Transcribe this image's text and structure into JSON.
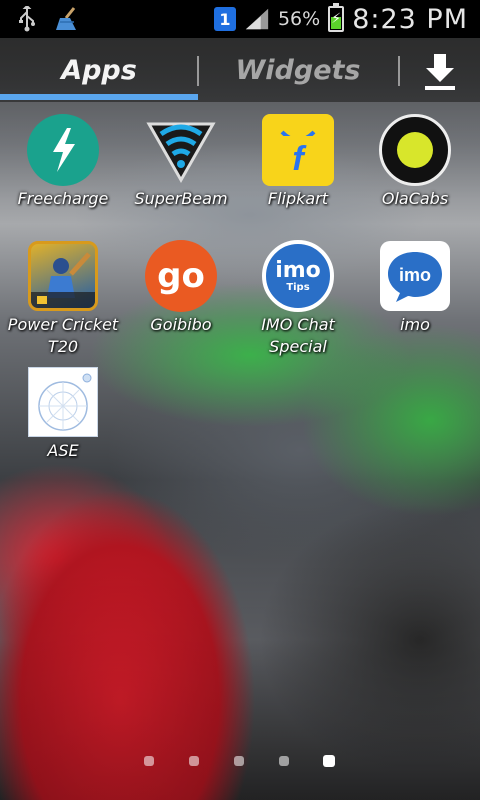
{
  "status_bar": {
    "left_icons": [
      "usb-icon",
      "broom-cleaner-icon"
    ],
    "sim_label": "1",
    "battery_percent": "56%",
    "battery_level": 0.56,
    "time": "8:23 PM"
  },
  "tabs": {
    "apps_label": "Apps",
    "widgets_label": "Widgets",
    "active": "apps"
  },
  "apps": [
    {
      "label": "Freecharge",
      "icon": "freecharge-icon"
    },
    {
      "label": "SuperBeam",
      "icon": "superbeam-icon"
    },
    {
      "label": "Flipkart",
      "icon": "flipkart-icon"
    },
    {
      "label": "OlaCabs",
      "icon": "olacabs-icon"
    },
    {
      "label": "Power Cricket\nT20",
      "icon": "power-cricket-icon"
    },
    {
      "label": "Goibibo",
      "icon": "goibibo-icon"
    },
    {
      "label": "IMO Chat\nSpecial",
      "icon": "imo-tips-icon",
      "badge_text": "imo",
      "badge_subtext": "Tips"
    },
    {
      "label": "imo",
      "icon": "imo-icon",
      "badge_text": "imo"
    },
    {
      "label": "ASE",
      "icon": "ase-icon"
    }
  ],
  "goibibo_text": "go",
  "pager": {
    "count": 5,
    "active_index": 4
  },
  "colors": {
    "tab_indicator": "#5aa6ee",
    "freecharge": "#1aa28d",
    "flipkart": "#f8d41a",
    "goibibo": "#ea5a22",
    "imo": "#2a6fc7"
  }
}
